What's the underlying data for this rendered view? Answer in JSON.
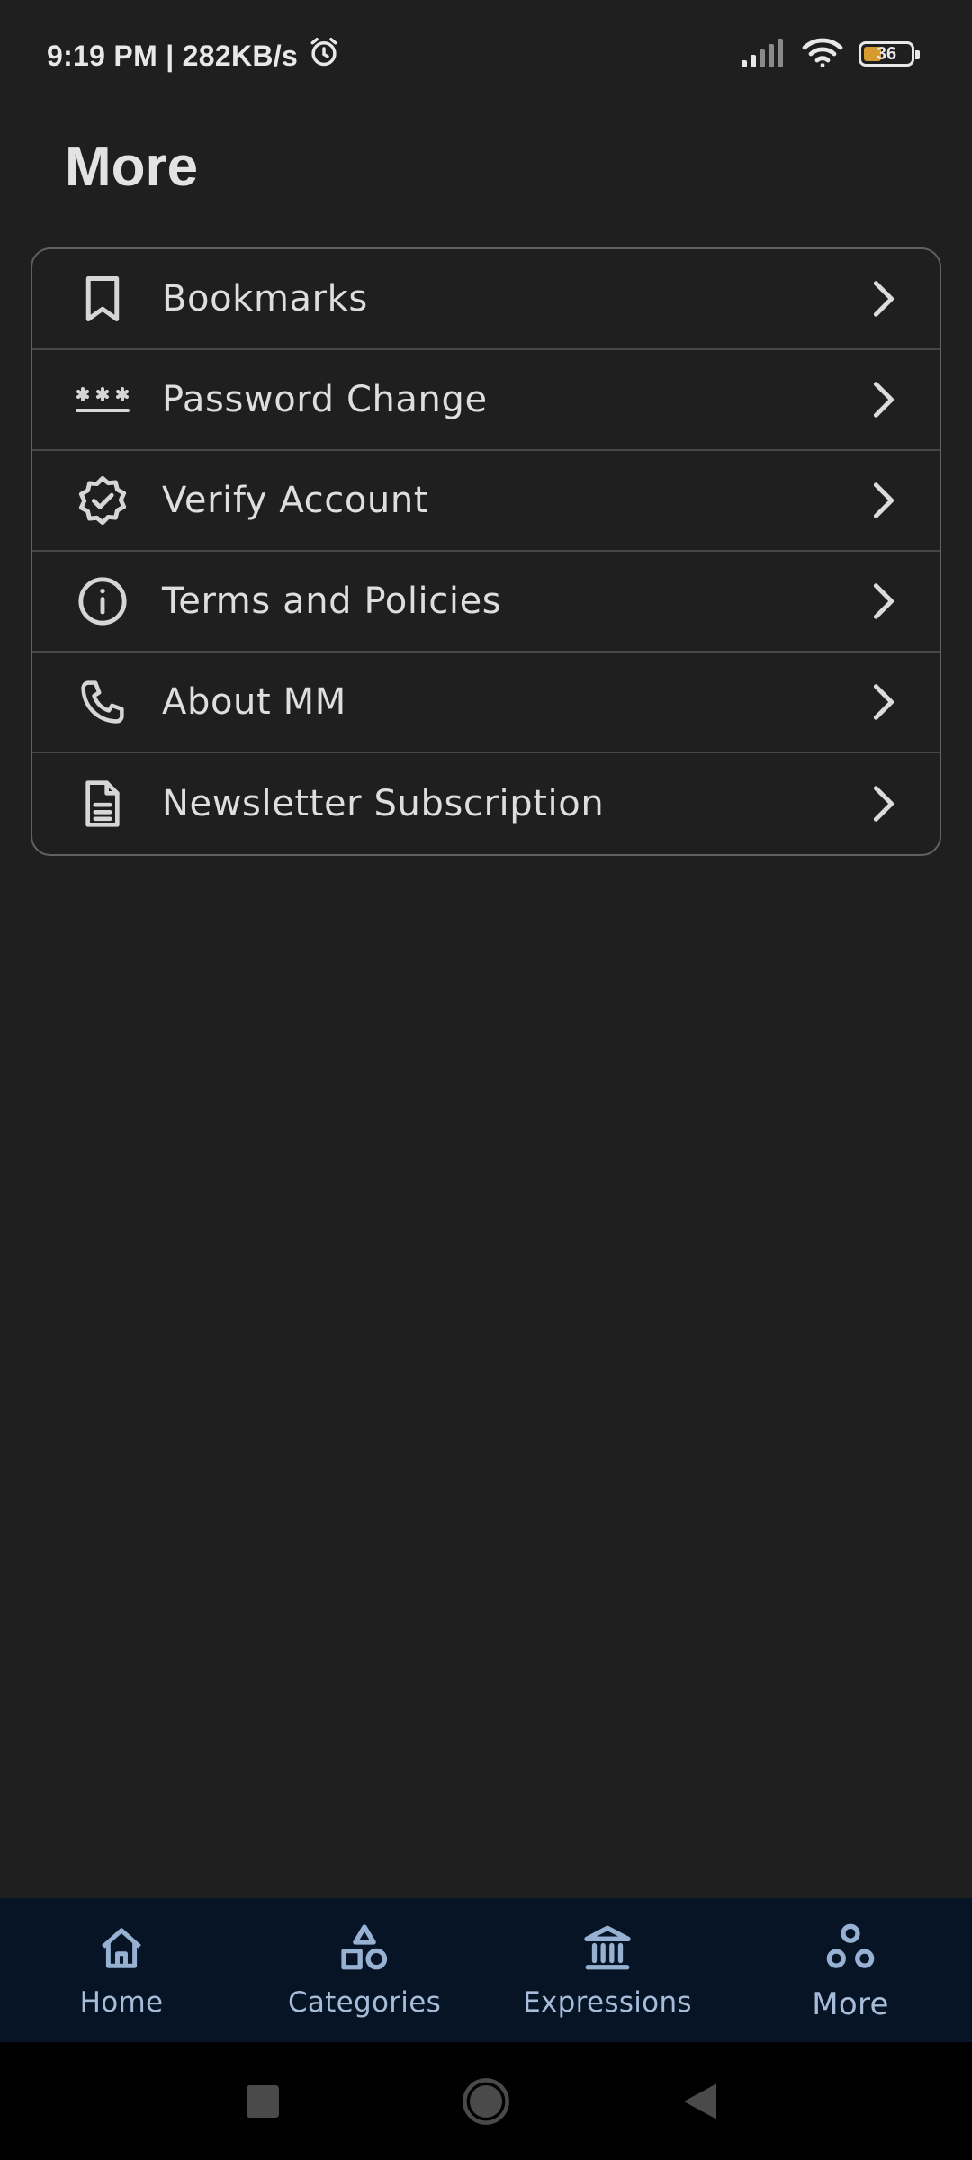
{
  "status_bar": {
    "time_speed": "9:19 PM | 282KB/s",
    "battery_level": "36",
    "icons": [
      "alarm-icon",
      "signal-icon",
      "wifi-icon",
      "battery-icon"
    ]
  },
  "page": {
    "title": "More"
  },
  "menu": {
    "items": [
      {
        "label": "Bookmarks",
        "icon": "bookmark-icon"
      },
      {
        "label": "Password Change",
        "icon": "password-icon"
      },
      {
        "label": "Verify Account",
        "icon": "verified-badge-icon"
      },
      {
        "label": "Terms and Policies",
        "icon": "info-icon"
      },
      {
        "label": "About MM",
        "icon": "phone-icon"
      },
      {
        "label": "Newsletter Subscription",
        "icon": "document-icon"
      }
    ]
  },
  "bottom_nav": {
    "items": [
      {
        "label": "Home",
        "icon": "home-icon"
      },
      {
        "label": "Categories",
        "icon": "shapes-icon"
      },
      {
        "label": "Expressions",
        "icon": "institution-icon"
      },
      {
        "label": "More",
        "icon": "more-circles-icon",
        "active": true
      }
    ]
  },
  "colors": {
    "background": "#1f1f1f",
    "card_border": "#616161",
    "nav_background": "#061426",
    "nav_accent": "#97b1d3",
    "battery_fill": "#d69a2d"
  }
}
